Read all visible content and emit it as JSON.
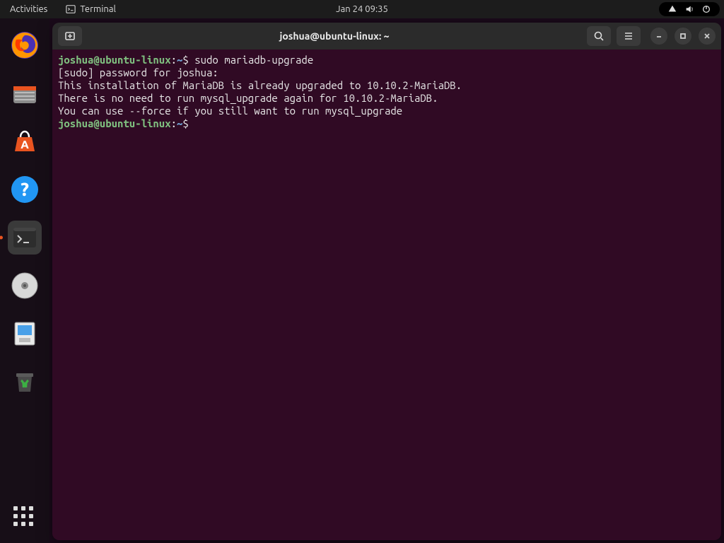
{
  "topbar": {
    "activities": "Activities",
    "app": "Terminal",
    "clock": "Jan 24  09:35"
  },
  "window": {
    "title": "joshua@ubuntu-linux: ~"
  },
  "terminal": {
    "user": "joshua@ubuntu-linux",
    "path": "~",
    "cmd1": "sudo mariadb-upgrade",
    "line1": "[sudo] password for joshua:",
    "line2": "This installation of MariaDB is already upgraded to 10.10.2-MariaDB.",
    "line3": "There is no need to run mysql_upgrade again for 10.10.2-MariaDB.",
    "line4": "You can use --force if you still want to run mysql_upgrade"
  },
  "dock": {
    "items": [
      "firefox",
      "files",
      "software",
      "help",
      "terminal",
      "disk",
      "floppy",
      "trash"
    ]
  }
}
